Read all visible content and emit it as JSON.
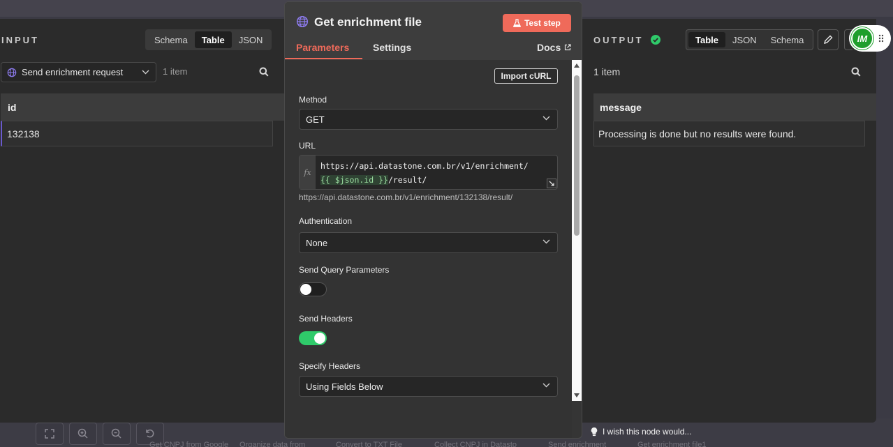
{
  "input": {
    "label": "INPUT",
    "view_tabs": [
      "Schema",
      "Table",
      "JSON"
    ],
    "active_tab": "Table",
    "source_node": "Send enrichment request",
    "item_count": "1 item",
    "columns": [
      "id"
    ],
    "rows": [
      [
        "132138"
      ]
    ]
  },
  "output": {
    "label": "OUTPUT",
    "view_tabs": [
      "Table",
      "JSON",
      "Schema"
    ],
    "active_tab": "Table",
    "item_count": "1 item",
    "columns": [
      "message"
    ],
    "rows": [
      [
        "Processing is done but no results were found."
      ]
    ]
  },
  "node": {
    "title": "Get enrichment file",
    "test_button": "Test step",
    "tabs": [
      "Parameters",
      "Settings"
    ],
    "docs_link": "Docs",
    "import_curl": "Import cURL",
    "method_label": "Method",
    "method_value": "GET",
    "url_label": "URL",
    "url_fx": "fx",
    "url_prefix": "https://api.datastone.com.br/v1/enrichment/",
    "url_expression": "{{ $json.id }}",
    "url_suffix": "/result/",
    "url_resolved": "https://api.datastone.com.br/v1/enrichment/132138/result/",
    "auth_label": "Authentication",
    "auth_value": "None",
    "query_params_label": "Send Query Parameters",
    "query_params_enabled": false,
    "headers_label": "Send Headers",
    "headers_enabled": true,
    "specify_headers_label": "Specify Headers",
    "specify_headers_value": "Using Fields Below"
  },
  "hint": "I wish this node would...",
  "avatar_initials": "IM",
  "canvas_nodes": [
    "Get CNPJ from Google",
    "Organize data from",
    "Convert to TXT File",
    "Collect CNPJ in Datasto",
    "Send enrichment",
    "Get enrichment file1"
  ],
  "colors": {
    "accent": "#ef6a5a",
    "toggle_on": "#2fca6a",
    "success": "#2fca6a",
    "avatar": "#1e9e2c"
  }
}
